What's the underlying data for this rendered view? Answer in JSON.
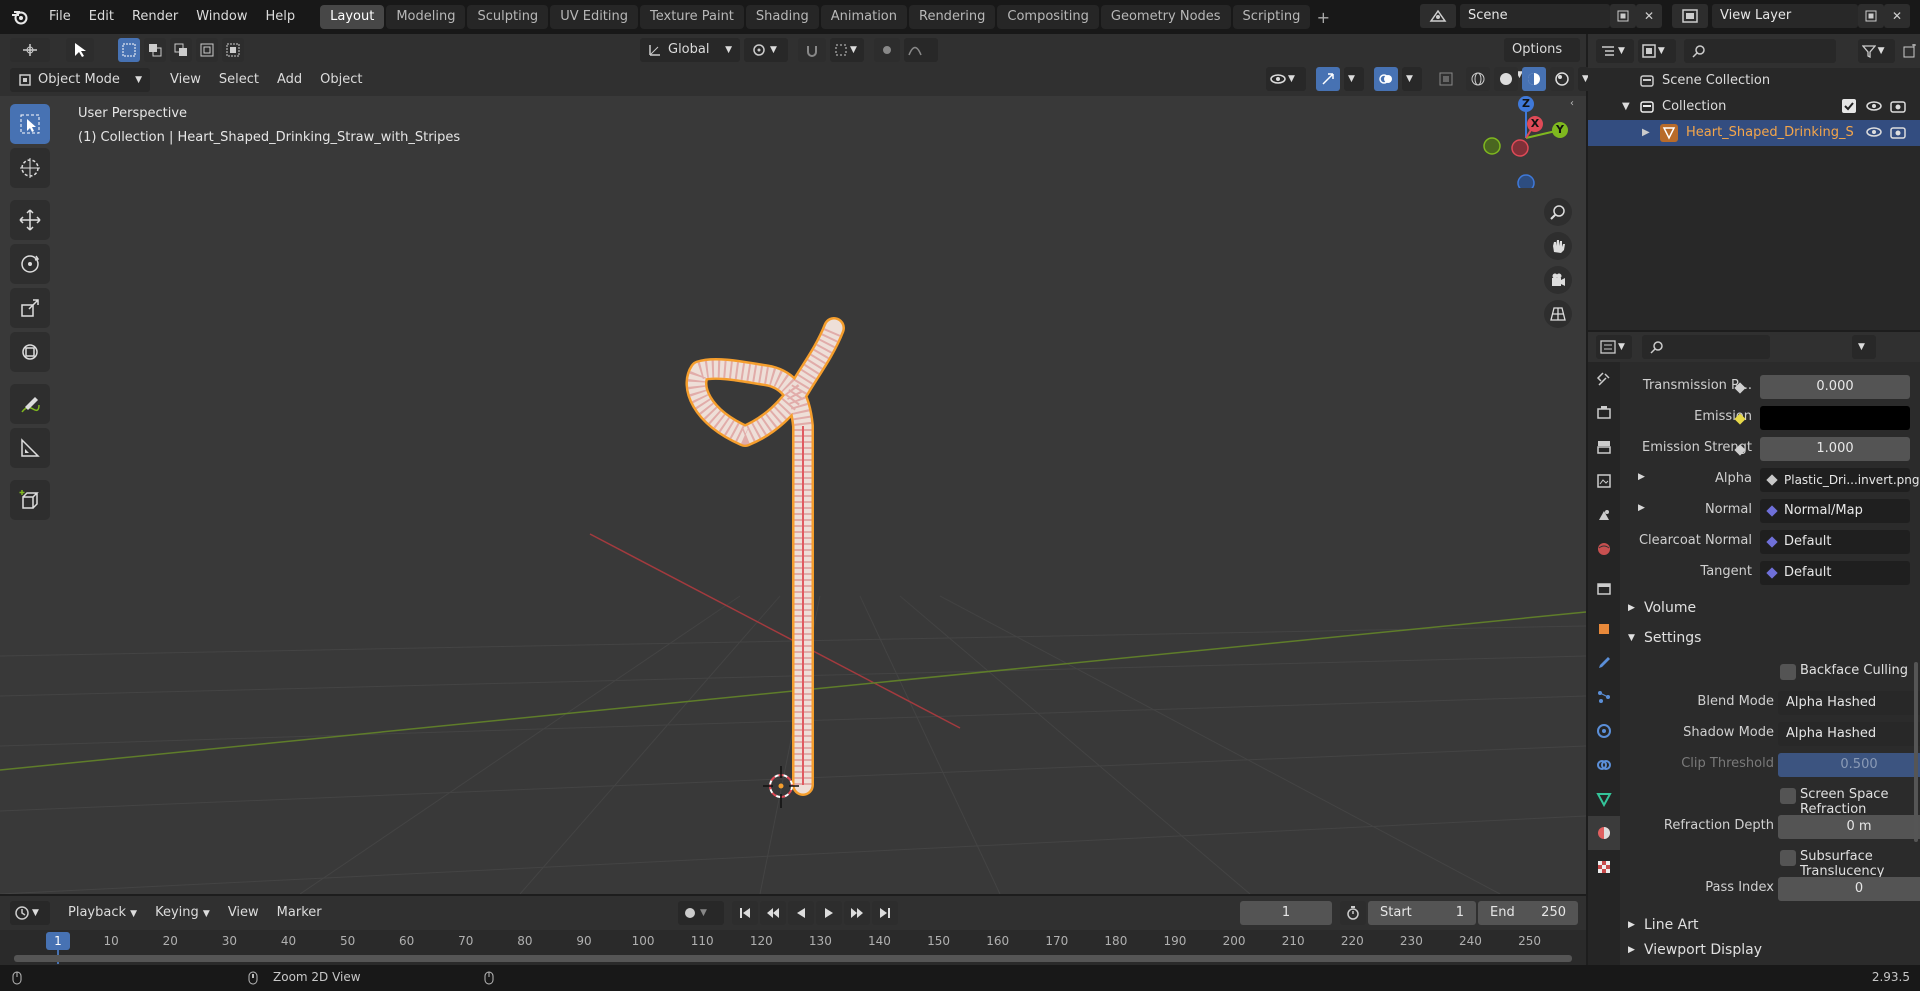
{
  "menu": [
    "File",
    "Edit",
    "Render",
    "Window",
    "Help"
  ],
  "workspaces": [
    "Layout",
    "Modeling",
    "Sculpting",
    "UV Editing",
    "Texture Paint",
    "Shading",
    "Animation",
    "Rendering",
    "Compositing",
    "Geometry Nodes",
    "Scripting"
  ],
  "active_workspace": "Layout",
  "scene": "Scene",
  "view_layer": "View Layer",
  "viewport_header": {
    "mode": "Object Mode",
    "menus": [
      "View",
      "Select",
      "Add",
      "Object"
    ],
    "transform_orientation": "Global",
    "options": "Options"
  },
  "viewport": {
    "perspective": "User Perspective",
    "object_info": "(1) Collection | Heart_Shaped_Drinking_Straw_with_Stripes",
    "gizmo": {
      "x": "X",
      "y": "Y",
      "z": "Z"
    }
  },
  "outliner": {
    "scene_collection": "Scene Collection",
    "collection": "Collection",
    "object": "Heart_Shaped_Drinking_S"
  },
  "properties": {
    "rows": {
      "transmission_label": "Transmission R...",
      "transmission_value": "0.000",
      "emission_label": "Emission",
      "emission_color": "#000000",
      "emission_strength_label": "Emission Strengt",
      "emission_strength_value": "1.000",
      "alpha_label": "Alpha",
      "alpha_value": "Plastic_Dri...invert.png",
      "normal_label": "Normal",
      "normal_value": "Normal/Map",
      "clearcoat_normal_label": "Clearcoat Normal",
      "clearcoat_normal_value": "Default",
      "tangent_label": "Tangent",
      "tangent_value": "Default"
    },
    "volume": "Volume",
    "settings": "Settings",
    "backface_culling": "Backface Culling",
    "blend_mode_label": "Blend Mode",
    "blend_mode_value": "Alpha Hashed",
    "shadow_mode_label": "Shadow Mode",
    "shadow_mode_value": "Alpha Hashed",
    "clip_threshold_label": "Clip Threshold",
    "clip_threshold_value": "0.500",
    "screen_space_refraction": "Screen Space Refraction",
    "refraction_depth_label": "Refraction Depth",
    "refraction_depth_value": "0 m",
    "subsurface_translucency": "Subsurface Translucency",
    "pass_index_label": "Pass Index",
    "pass_index_value": "0",
    "line_art": "Line Art",
    "viewport_display": "Viewport Display"
  },
  "timeline": {
    "menus": [
      "Playback",
      "Keying",
      "View",
      "Marker"
    ],
    "current_frame": "1",
    "start_label": "Start",
    "start_value": "1",
    "end_label": "End",
    "end_value": "250",
    "ruler": [
      "1",
      "10",
      "20",
      "30",
      "40",
      "50",
      "60",
      "70",
      "80",
      "90",
      "100",
      "110",
      "120",
      "130",
      "140",
      "150",
      "160",
      "170",
      "180",
      "190",
      "200",
      "210",
      "220",
      "230",
      "240",
      "250"
    ]
  },
  "status": {
    "hint": "Zoom 2D View",
    "version": "2.93.5"
  },
  "colors": {
    "accent": "#4772b3",
    "selection_orange": "#f59e2d",
    "axis_x": "#e04a57",
    "axis_y": "#7fb81f",
    "axis_z": "#3f79d9"
  }
}
